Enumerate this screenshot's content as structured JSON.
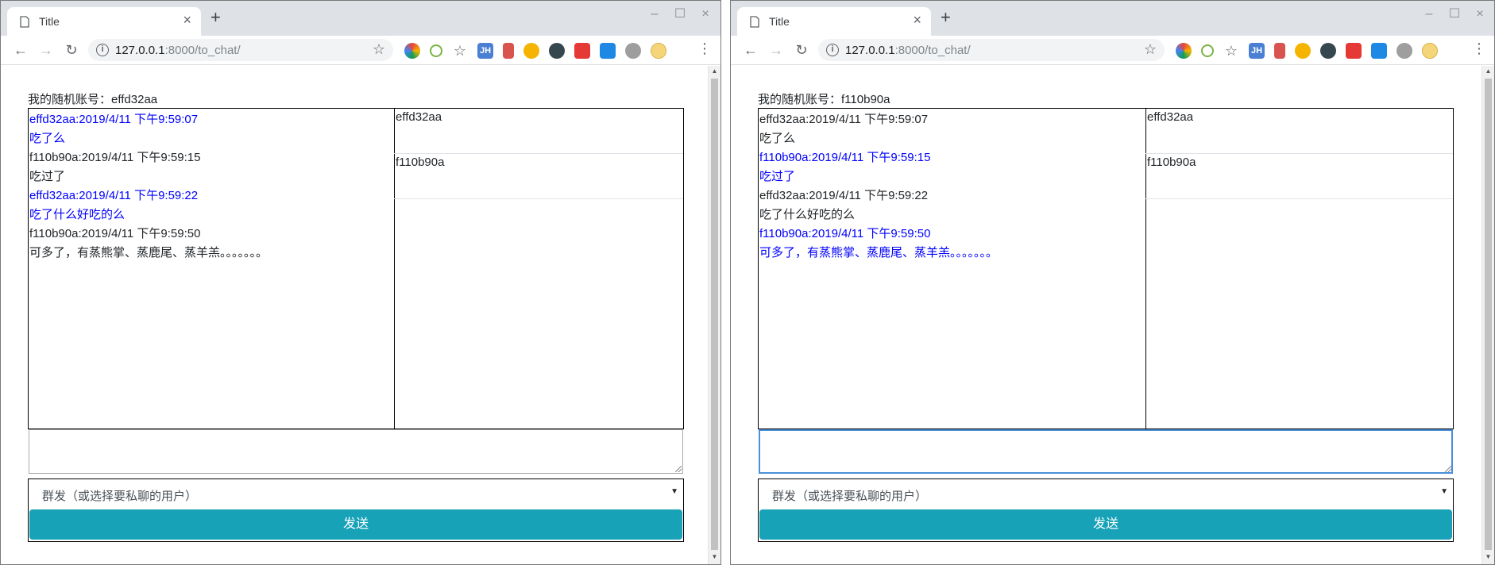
{
  "windows": [
    {
      "tab_title": "Title",
      "url_host": "127.0.0.1",
      "url_rest": ":8000/to_chat/",
      "account_label": "我的随机账号：",
      "account_id": "effd32aa",
      "messages": [
        {
          "text": "effd32aa:2019/4/11 下午9:59:07",
          "self": true
        },
        {
          "text": "吃了么",
          "self": true
        },
        {
          "text": "f110b90a:2019/4/11 下午9:59:15",
          "self": false
        },
        {
          "text": "吃过了",
          "self": false
        },
        {
          "text": "effd32aa:2019/4/11 下午9:59:22",
          "self": true
        },
        {
          "text": "吃了什么好吃的么",
          "self": true
        },
        {
          "text": "f110b90a:2019/4/11 下午9:59:50",
          "self": false
        },
        {
          "text": "可多了，有蒸熊掌、蒸鹿尾、蒸羊羔。。。。。。。",
          "self": false
        }
      ],
      "users": [
        "effd32aa",
        "f110b90a"
      ],
      "select_label": "群发（或选择要私聊的用户）",
      "send_label": "发送"
    },
    {
      "tab_title": "Title",
      "url_host": "127.0.0.1",
      "url_rest": ":8000/to_chat/",
      "account_label": "我的随机账号：",
      "account_id": "f110b90a",
      "messages": [
        {
          "text": "effd32aa:2019/4/11 下午9:59:07",
          "self": false
        },
        {
          "text": "吃了么",
          "self": false
        },
        {
          "text": "f110b90a:2019/4/11 下午9:59:15",
          "self": true
        },
        {
          "text": "吃过了",
          "self": true
        },
        {
          "text": "effd32aa:2019/4/11 下午9:59:22",
          "self": false
        },
        {
          "text": "吃了什么好吃的么",
          "self": false
        },
        {
          "text": "f110b90a:2019/4/11 下午9:59:50",
          "self": true
        },
        {
          "text": "可多了，有蒸熊掌、蒸鹿尾、蒸羊羔。。。。。。。",
          "self": true
        }
      ],
      "users": [
        "effd32aa",
        "f110b90a"
      ],
      "select_label": "群发（或选择要私聊的用户）",
      "send_label": "发送"
    }
  ],
  "icons": {
    "tab_close": "×",
    "new_tab": "+",
    "minimize": "–",
    "maximize": "☐",
    "close": "×",
    "back": "←",
    "forward": "→",
    "reload": "↻",
    "info": "i",
    "star": "☆",
    "menu": "⋮",
    "caret": "▼",
    "scroll_up": "▲",
    "scroll_down": "▼"
  },
  "extensions": [
    {
      "name": "color-wheel-icon",
      "color": "#e8453c"
    },
    {
      "name": "lime-icon",
      "color": "#7cb342"
    },
    {
      "name": "bookmark-star-icon",
      "color": "#5f6368"
    },
    {
      "name": "jh-icon",
      "color": "#4a7fd4",
      "label": "JH"
    },
    {
      "name": "office-icon",
      "color": "#d9534f"
    },
    {
      "name": "compass-icon",
      "color": "#f4b400"
    },
    {
      "name": "circle-e-icon",
      "color": "#37474f"
    },
    {
      "name": "shield-icon",
      "color": "#e53935"
    },
    {
      "name": "s-icon",
      "color": "#1e88e5"
    },
    {
      "name": "grey-circle-icon",
      "color": "#9e9e9e"
    }
  ],
  "colors": {
    "self_message": "#0000ff",
    "other_message": "#212529",
    "send_button": "#17a2b8"
  }
}
